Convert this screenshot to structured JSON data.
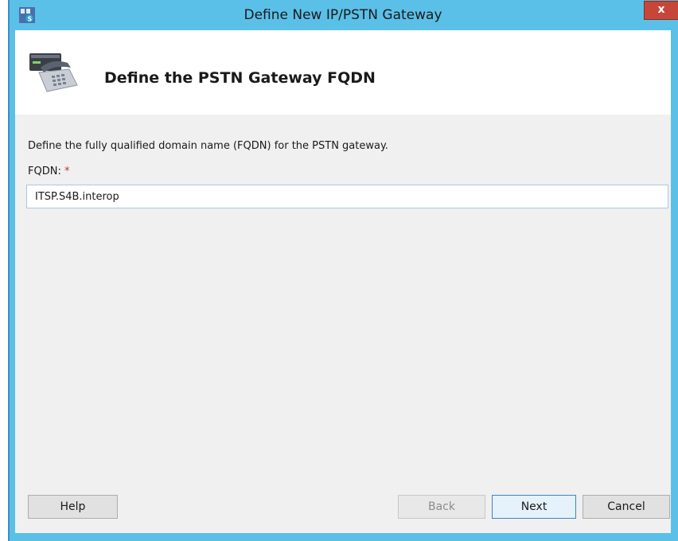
{
  "window": {
    "title": "Define New IP/PSTN Gateway",
    "close_label": "x"
  },
  "header": {
    "heading": "Define the PSTN Gateway FQDN",
    "icon": "telephone-gateway-icon"
  },
  "content": {
    "instruction": "Define the fully qualified domain name (FQDN) for the PSTN gateway.",
    "fqdn_label": "FQDN:",
    "required_marker": "*",
    "fqdn_value": "ITSP.S4B.interop"
  },
  "buttons": {
    "help": "Help",
    "back": "Back",
    "next": "Next",
    "cancel": "Cancel"
  },
  "colors": {
    "titlebar": "#5bc0e8",
    "close": "#c7463a",
    "required": "#c8302a",
    "next_border": "#3c84c8"
  }
}
